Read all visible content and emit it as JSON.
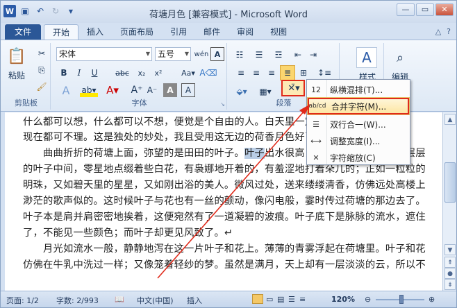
{
  "window": {
    "title": "荷塘月色 [兼容模式] - Microsoft Word"
  },
  "tabs": [
    {
      "label": "文件"
    },
    {
      "label": "开始"
    },
    {
      "label": "插入"
    },
    {
      "label": "页面布局"
    },
    {
      "label": "引用"
    },
    {
      "label": "邮件"
    },
    {
      "label": "审阅"
    },
    {
      "label": "视图"
    }
  ],
  "ribbon": {
    "clipboard": {
      "paste": "粘贴",
      "label": "剪贴板"
    },
    "font": {
      "name": "宋体",
      "size": "五号",
      "label": "字体"
    },
    "paragraph": {
      "label": "段落"
    },
    "styles": {
      "label": "样式"
    },
    "editing": {
      "label": "编辑"
    }
  },
  "menu": {
    "items": [
      {
        "label": "纵横混排(T)...",
        "icon": "12"
      },
      {
        "label": "合并字符(M)...",
        "icon": "ab/cd"
      },
      {
        "label": "双行合一(W)...",
        "icon": ""
      },
      {
        "label": "调整宽度(I)...",
        "icon": ""
      },
      {
        "label": "字符缩放(C)",
        "icon": "✕"
      }
    ]
  },
  "document": {
    "lines": [
      "什么都可以想，什么都可以不想，便觉是个自由的人。白天里一定要做的事，一定要",
      "现在都可不理。这是独处的妙处，我且受用这无边的荷香月色好了。",
      "　　曲曲折折的荷塘上面，弥望的是田田的叶子。",
      "叶子",
      "出水很高，像亭亭的舞女的裙。层层",
      "的叶子中间，零星地点缀着些白花，有袅娜地开着的，有羞涩地打着朵儿的；正如一粒粒的",
      "明珠，又如碧天里的星星，又如刚出浴的美人。微风过处，送来缕缕清香，仿佛远处高楼上",
      "渺茫的歌声似的。这时候叶子与花也有一丝的颤动，像闪电般，霎时传过荷塘的那边去了。",
      "叶子本是肩并肩密密地挨着，这便宛然有了一道凝碧的波痕。叶子底下是脉脉的流水，遮住",
      "了，不能见一些颜色；而叶子却更见风致了。↵",
      "　　月光如流水一般，静静地泻在这一片叶子和花上。薄薄的青雾浮起在荷塘里。叶子和花",
      "仿佛在牛乳中洗过一样；又像笼着轻纱的梦。虽然是满月，天上却有一层淡淡的云，所以不"
    ]
  },
  "status": {
    "page": "页面: 1/2",
    "words": "字数: 2/993",
    "lang": "中文(中国)",
    "mode": "插入",
    "zoom": "120%"
  }
}
